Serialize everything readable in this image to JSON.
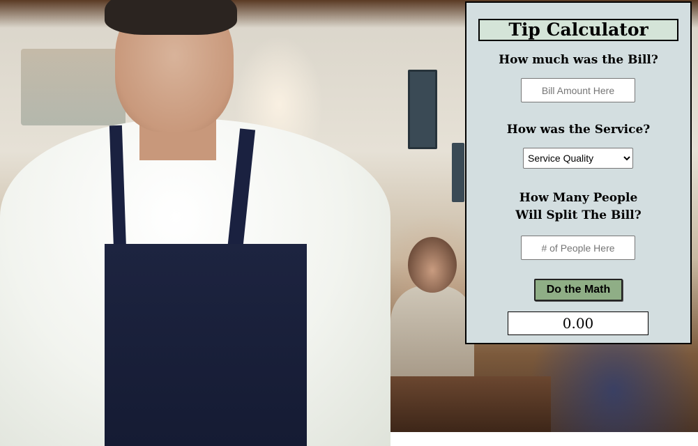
{
  "calculator": {
    "title": "Tip Calculator",
    "bill_question": "How much was the Bill?",
    "bill_placeholder": "Bill Amount Here",
    "service_question": "How was the Service?",
    "service_selected": "Service Quality",
    "people_question_line1": "How Many People",
    "people_question_line2": "Will Split The Bill?",
    "people_placeholder": "# of People Here",
    "button_label": "Do the Math",
    "result_value": "0.00"
  },
  "colors": {
    "panel_bg": "#d3dee0",
    "title_bg": "#d4e4d8",
    "button_bg": "#8fae86"
  },
  "background": {
    "scene": "waiter-restaurant-photo"
  }
}
